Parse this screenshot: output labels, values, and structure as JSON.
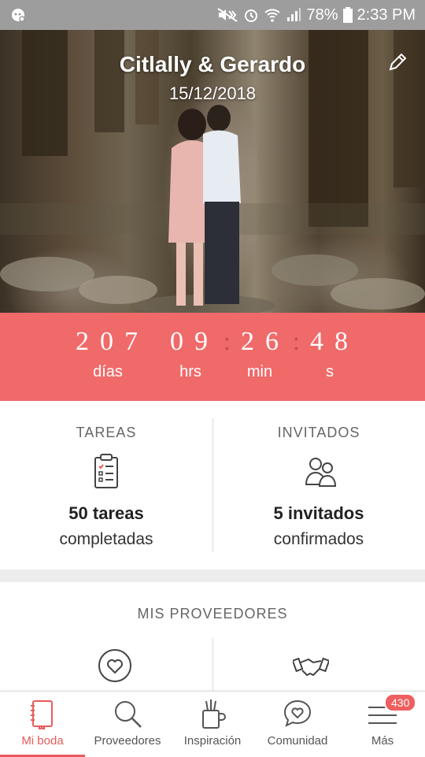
{
  "status_bar": {
    "battery": "78%",
    "time": "2:33 PM"
  },
  "hero": {
    "couple_names": "Citlally & Gerardo",
    "wedding_date": "15/12/2018"
  },
  "countdown": {
    "days": "207",
    "hours": "09",
    "minutes": "26",
    "seconds": "48",
    "days_label": "días",
    "hours_label": "hrs",
    "minutes_label": "min",
    "seconds_label": "s",
    "separator": ":"
  },
  "summary": {
    "tasks": {
      "title": "TAREAS",
      "count": "50 tareas",
      "subtitle": "completadas"
    },
    "guests": {
      "title": "INVITADOS",
      "count": "5 invitados",
      "subtitle": "confirmados"
    }
  },
  "providers": {
    "title": "MIS PROVEEDORES"
  },
  "bottom_nav": {
    "items": [
      {
        "label": "Mi boda",
        "icon": "notebook-icon",
        "active": true
      },
      {
        "label": "Proveedores",
        "icon": "search-icon",
        "active": false
      },
      {
        "label": "Inspiración",
        "icon": "inspiration-icon",
        "active": false
      },
      {
        "label": "Comunidad",
        "icon": "chat-heart-icon",
        "active": false
      },
      {
        "label": "Más",
        "icon": "menu-icon",
        "active": false,
        "badge": "430"
      }
    ]
  },
  "colors": {
    "accent": "#f06a6a",
    "status_bar": "#9d9d9d"
  }
}
